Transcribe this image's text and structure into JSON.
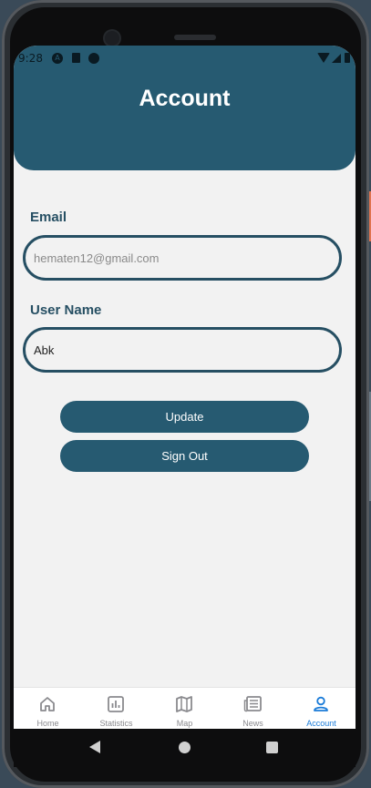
{
  "status_bar": {
    "time": "9:28"
  },
  "header": {
    "title": "Account"
  },
  "form": {
    "email_label": "Email",
    "email_value": "hematen12@gmail.com",
    "username_label": "User Name",
    "username_value": "Abk"
  },
  "buttons": {
    "update": "Update",
    "sign_out": "Sign Out"
  },
  "tabs": [
    {
      "label": "Home",
      "icon": "home-icon"
    },
    {
      "label": "Statistics",
      "icon": "bar-chart-icon"
    },
    {
      "label": "Map",
      "icon": "map-icon"
    },
    {
      "label": "News",
      "icon": "newspaper-icon"
    },
    {
      "label": "Account",
      "icon": "person-icon",
      "active": true
    }
  ],
  "colors": {
    "primary": "#265a71",
    "field_border": "#264f63",
    "active_tab": "#1a7bd8",
    "inactive_tab": "#8a8a8e",
    "background": "#f2f2f2"
  }
}
